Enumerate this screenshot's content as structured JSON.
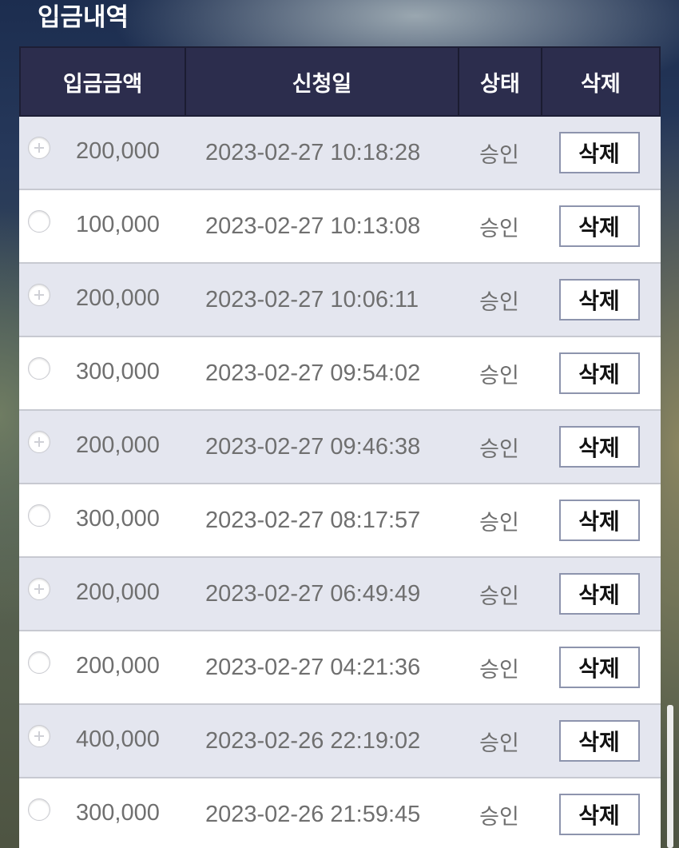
{
  "page": {
    "title": "입금내역"
  },
  "table": {
    "headers": {
      "amount": "입금금액",
      "date": "신청일",
      "status": "상태",
      "delete": "삭제"
    },
    "rows": [
      {
        "amount": "200,000",
        "date": "2023-02-27 10:18:28",
        "status": "승인",
        "delete_label": "삭제",
        "radio_icon": "plus-circle-icon"
      },
      {
        "amount": "100,000",
        "date": "2023-02-27 10:13:08",
        "status": "승인",
        "delete_label": "삭제",
        "radio_icon": "radio-circle-icon"
      },
      {
        "amount": "200,000",
        "date": "2023-02-27 10:06:11",
        "status": "승인",
        "delete_label": "삭제",
        "radio_icon": "plus-circle-icon"
      },
      {
        "amount": "300,000",
        "date": "2023-02-27 09:54:02",
        "status": "승인",
        "delete_label": "삭제",
        "radio_icon": "radio-circle-icon"
      },
      {
        "amount": "200,000",
        "date": "2023-02-27 09:46:38",
        "status": "승인",
        "delete_label": "삭제",
        "radio_icon": "plus-circle-icon"
      },
      {
        "amount": "300,000",
        "date": "2023-02-27 08:17:57",
        "status": "승인",
        "delete_label": "삭제",
        "radio_icon": "radio-circle-icon"
      },
      {
        "amount": "200,000",
        "date": "2023-02-27 06:49:49",
        "status": "승인",
        "delete_label": "삭제",
        "radio_icon": "plus-circle-icon"
      },
      {
        "amount": "200,000",
        "date": "2023-02-27 04:21:36",
        "status": "승인",
        "delete_label": "삭제",
        "radio_icon": "radio-circle-icon"
      },
      {
        "amount": "400,000",
        "date": "2023-02-26 22:19:02",
        "status": "승인",
        "delete_label": "삭제",
        "radio_icon": "plus-circle-icon"
      },
      {
        "amount": "300,000",
        "date": "2023-02-26 21:59:45",
        "status": "승인",
        "delete_label": "삭제",
        "radio_icon": "radio-circle-icon"
      }
    ]
  },
  "colors": {
    "header_bg": "#2c2d4d",
    "row_alt_bg": "#e4e6ef",
    "row_plain_bg": "#ffffff",
    "text": "#6f6f6f",
    "button_border": "#8d94ad"
  }
}
